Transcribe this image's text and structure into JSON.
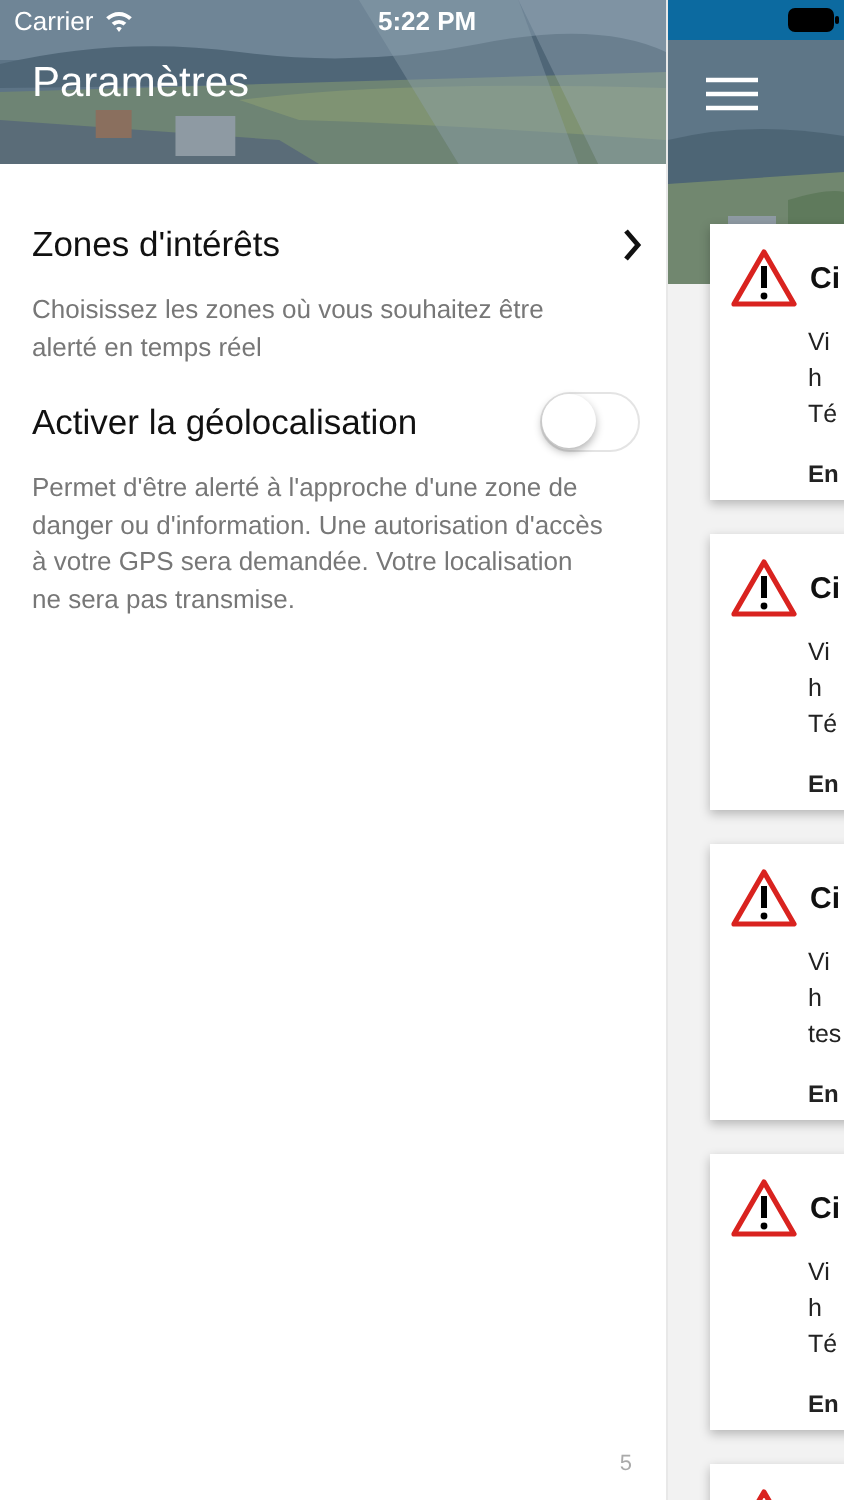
{
  "status_bar": {
    "carrier": "Carrier",
    "time": "5:22 PM"
  },
  "drawer": {
    "title": "Paramètres",
    "settings": [
      {
        "kind": "link",
        "label": "Zones d'intérêts",
        "description": "Choisissez les zones où vous souhaitez être alerté en temps réel"
      },
      {
        "kind": "toggle",
        "label": "Activer la géolocalisation",
        "on": false,
        "description": "Permet d'être alerté à l'approche d'une zone de danger ou d'information. Une autorisation d'accès à votre GPS sera demandée. Votre localisation ne sera pas transmise."
      }
    ],
    "page_number": "5"
  },
  "alerts": [
    {
      "title": "Ci",
      "lines": [
        "Vi",
        "h",
        "Té"
      ],
      "footer": "En"
    },
    {
      "title": "Ci",
      "lines": [
        "Vi",
        "h",
        "Té"
      ],
      "footer": "En"
    },
    {
      "title": "Ci",
      "lines": [
        "Vi",
        "h",
        "tes"
      ],
      "footer": "En"
    },
    {
      "title": "Ci",
      "lines": [
        "Vi",
        "h",
        "Té"
      ],
      "footer": "En"
    }
  ]
}
